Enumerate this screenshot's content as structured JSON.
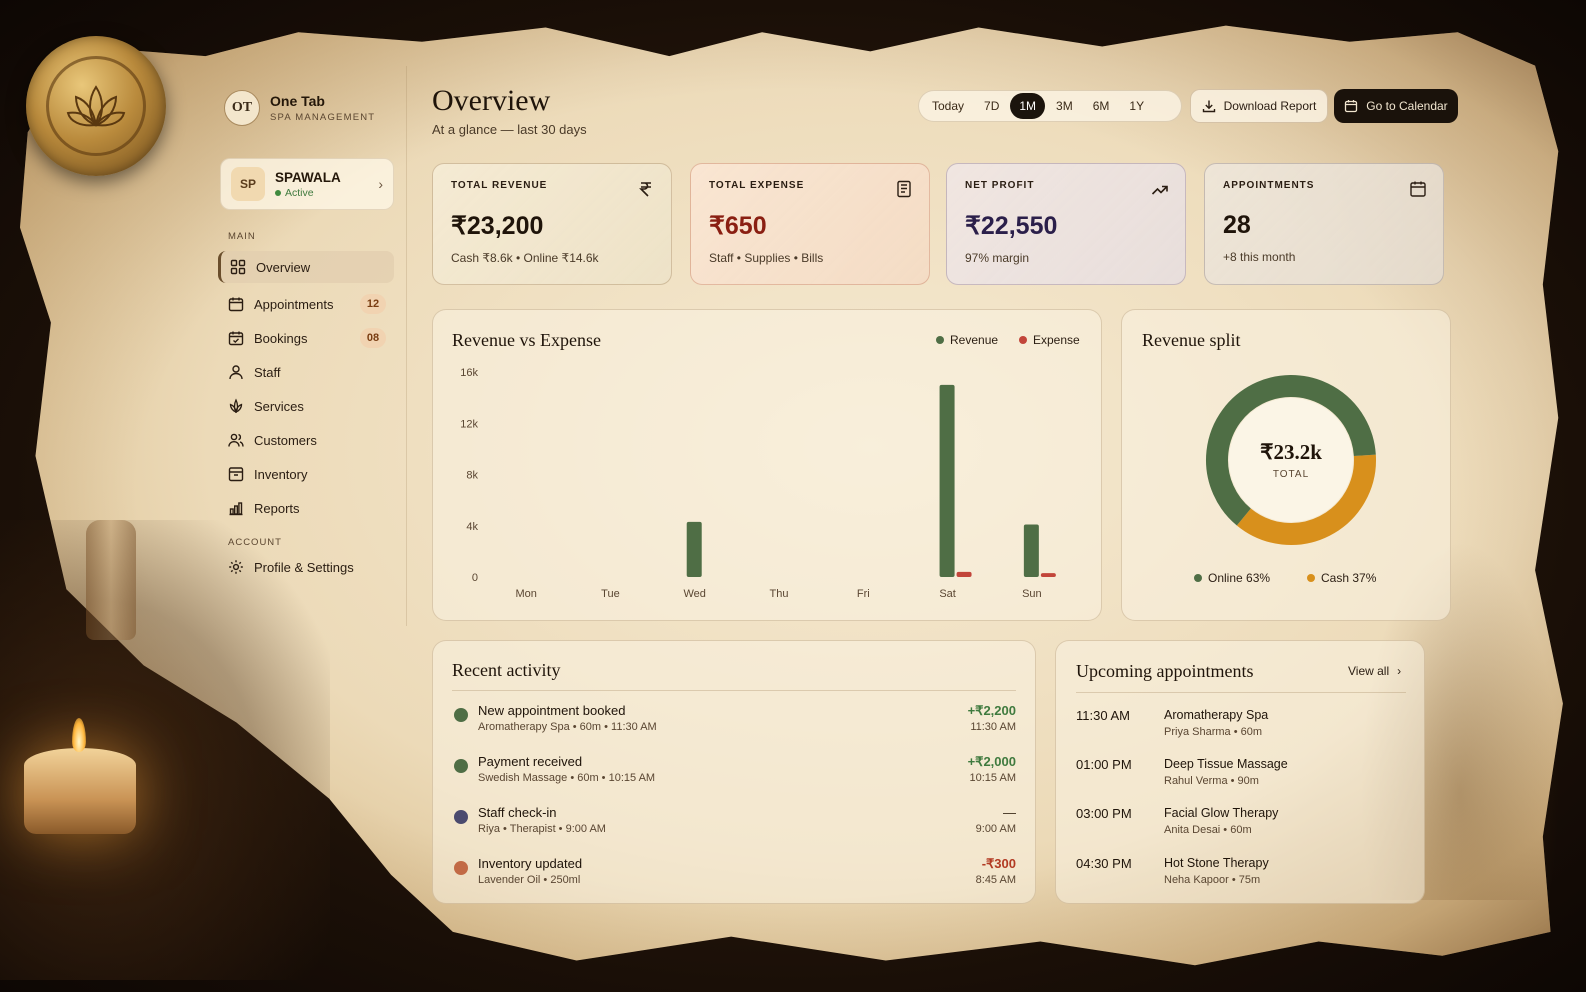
{
  "brand": {
    "title": "One Tab",
    "subtitle": "SPA MANAGEMENT",
    "logo_text": "OT"
  },
  "account": {
    "initials": "SP",
    "name": "SPAWALA",
    "status": "Active"
  },
  "sidebar": {
    "main_label": "MAIN",
    "account_label": "ACCOUNT",
    "items": [
      {
        "label": "Overview",
        "icon": "grid-icon",
        "active": true
      },
      {
        "label": "Appointments",
        "icon": "calendar-icon",
        "badge": "12"
      },
      {
        "label": "Bookings",
        "icon": "calendar-check-icon",
        "badge": "08"
      },
      {
        "label": "Staff",
        "icon": "user-icon"
      },
      {
        "label": "Services",
        "icon": "lotus-icon"
      },
      {
        "label": "Customers",
        "icon": "users-icon"
      },
      {
        "label": "Inventory",
        "icon": "box-icon"
      },
      {
        "label": "Reports",
        "icon": "bar-chart-icon"
      }
    ],
    "settings": {
      "label": "Profile & Settings",
      "icon": "gear-icon"
    }
  },
  "header": {
    "title": "Overview",
    "subtitle": "At a glance — last 30 days",
    "ranges": [
      "Today",
      "7D",
      "1M",
      "3M",
      "6M",
      "1Y"
    ],
    "active_range": "1M",
    "download_label": "Download Report",
    "calendar_label": "Go to Calendar"
  },
  "stats": [
    {
      "label": "TOTAL REVENUE",
      "value": "₹23,200",
      "note": "Cash ₹8.6k • Online ₹14.6k",
      "icon": "rupee-icon"
    },
    {
      "label": "TOTAL EXPENSE",
      "value": "₹650",
      "note": "Staff • Supplies • Bills",
      "icon": "receipt-icon"
    },
    {
      "label": "NET PROFIT",
      "value": "₹22,550",
      "note": "97% margin",
      "icon": "trend-up-icon"
    },
    {
      "label": "APPOINTMENTS",
      "value": "28",
      "note": "+8 this month",
      "icon": "calendar-icon"
    }
  ],
  "colors": {
    "revenue": "#4f6e45",
    "expense": "#c2453a",
    "online": "#4f6e45",
    "cash": "#d8901c"
  },
  "chart_data": [
    {
      "type": "bar",
      "title": "Revenue vs Expense",
      "categories": [
        "Mon",
        "Tue",
        "Wed",
        "Thu",
        "Fri",
        "Sat",
        "Sun"
      ],
      "series": [
        {
          "name": "Revenue",
          "values": [
            0,
            0,
            4300,
            0,
            0,
            15000,
            4100
          ]
        },
        {
          "name": "Expense",
          "values": [
            0,
            0,
            0,
            0,
            0,
            400,
            300
          ]
        }
      ],
      "yticks": [
        "0",
        "4k",
        "8k",
        "12k",
        "16k"
      ],
      "ylim": [
        0,
        16000
      ],
      "legend": "top-right"
    },
    {
      "type": "pie",
      "title": "Revenue split",
      "center_value": "₹23.2k",
      "center_label": "TOTAL",
      "slices": [
        {
          "name": "Online",
          "value": 63,
          "label": "Online 63%"
        },
        {
          "name": "Cash",
          "value": 37,
          "label": "Cash 37%"
        }
      ]
    }
  ],
  "activity": {
    "title": "Recent activity",
    "items": [
      {
        "title": "New appointment booked",
        "sub": "Aromatherapy Spa • 60m • 11:30 AM",
        "amount": "+₹2,200",
        "time": "11:30 AM",
        "color": "#4f6e45",
        "amount_color": "#3f7a3e"
      },
      {
        "title": "Payment received",
        "sub": "Swedish Massage • 60m • 10:15 AM",
        "amount": "+₹2,000",
        "time": "10:15 AM",
        "color": "#4f6e45",
        "amount_color": "#3f7a3e"
      },
      {
        "title": "Staff check-in",
        "sub": "Riya • Therapist • 9:00 AM",
        "amount": "—",
        "time": "9:00 AM",
        "color": "#4b4a6e",
        "amount_color": "#3a2a18"
      },
      {
        "title": "Inventory updated",
        "sub": "Lavender Oil • 250ml",
        "amount": "-₹300",
        "time": "8:45 AM",
        "color": "#c26a45",
        "amount_color": "#b23a22"
      }
    ]
  },
  "appointments": {
    "title": "Upcoming appointments",
    "view_all": "View all",
    "items": [
      {
        "time": "11:30 AM",
        "service": "Aromatherapy Spa",
        "sub": "Priya Sharma • 60m"
      },
      {
        "time": "01:00 PM",
        "service": "Deep Tissue Massage",
        "sub": "Rahul Verma • 90m"
      },
      {
        "time": "03:00 PM",
        "service": "Facial Glow Therapy",
        "sub": "Anita Desai • 60m"
      },
      {
        "time": "04:30 PM",
        "service": "Hot Stone Therapy",
        "sub": "Neha Kapoor • 75m"
      }
    ]
  }
}
